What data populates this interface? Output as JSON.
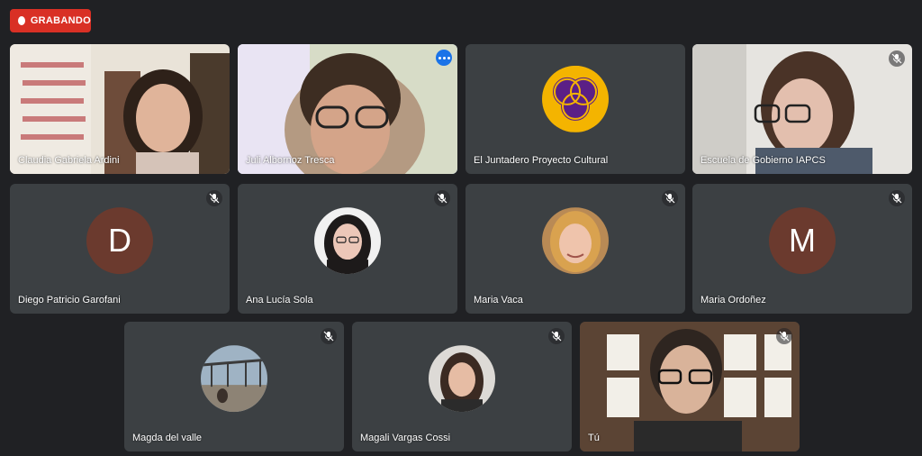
{
  "recording": {
    "label": "GRABANDO"
  },
  "participants": [
    {
      "name": "Claudia Gabriela Ardini"
    },
    {
      "name": "Juli Albornoz Tresca"
    },
    {
      "name": "El Juntadero Proyecto Cultural"
    },
    {
      "name": "Escuela de Gobierno IAPCS"
    },
    {
      "name": "Diego Patricio Garofani",
      "initial": "D"
    },
    {
      "name": "Ana Lucía Sola"
    },
    {
      "name": "Maria Vaca"
    },
    {
      "name": "Maria Ordoñez",
      "initial": "M"
    },
    {
      "name": "Magda del valle"
    },
    {
      "name": "Magali Vargas Cossi"
    },
    {
      "name": "Tú"
    }
  ],
  "colors": {
    "recording": "#d93025",
    "active_border": "#8ab4f8",
    "tile_bg": "#3c4043",
    "avatar_bg": "#6b3a2e",
    "logo_bg": "#f4b400",
    "logo_fg": "#5b1f86"
  }
}
